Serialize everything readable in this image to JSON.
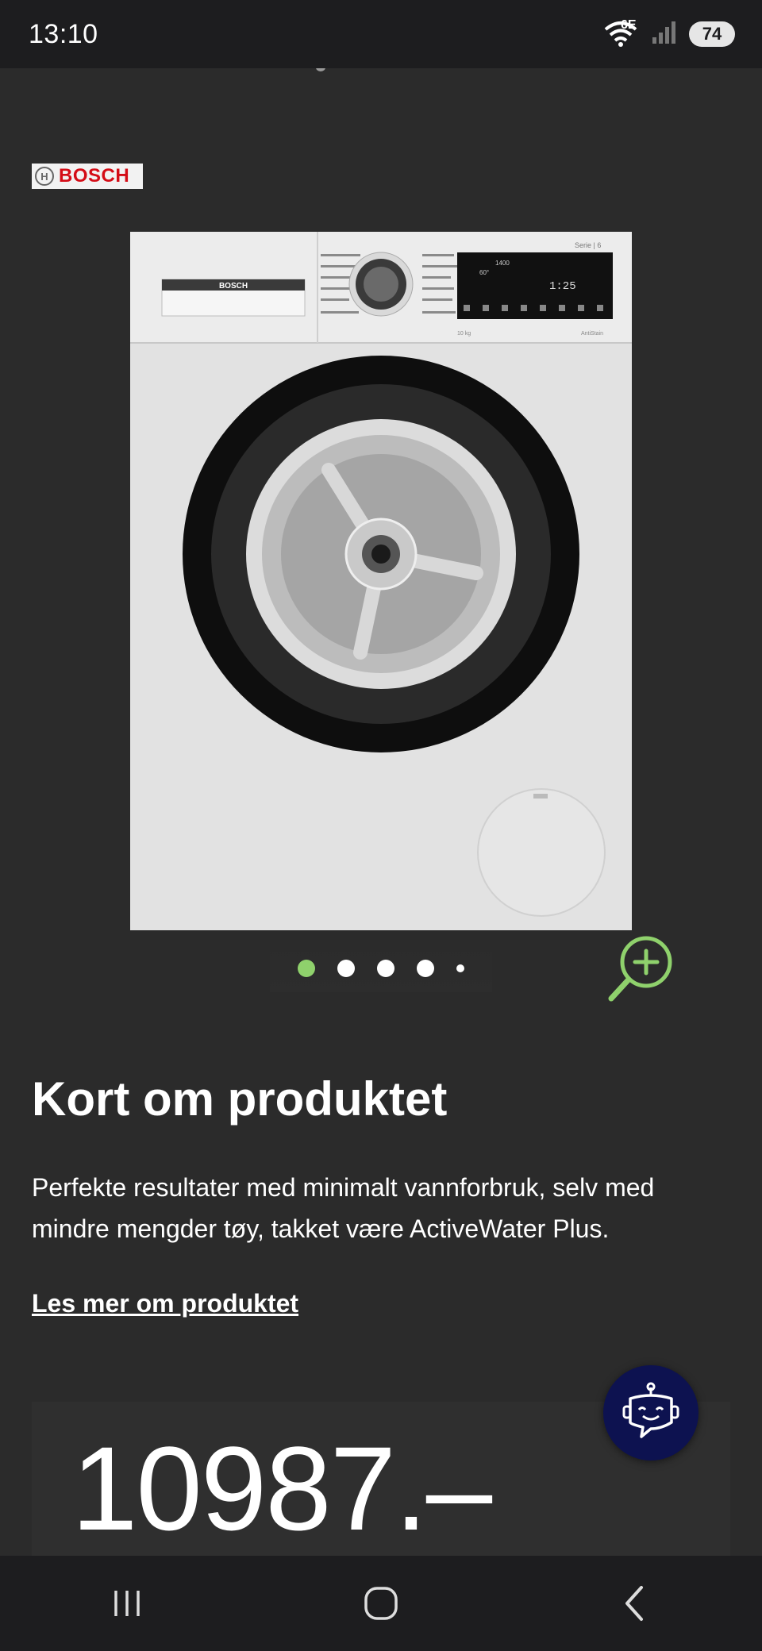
{
  "status_bar": {
    "time": "13:10",
    "network": "6E",
    "battery": "74",
    "icons": [
      "wifi-icon",
      "signal-icon",
      "battery-icon"
    ]
  },
  "brand": {
    "name": "BOSCH"
  },
  "product_image": {
    "panel_brand": "BOSCH",
    "serie_label": "Serie | 6",
    "display_rpm": "1400",
    "display_temp": "60°",
    "display_time": "1:25",
    "capacity": "10 kg",
    "antistain": "AntiStain"
  },
  "carousel": {
    "slides": 5,
    "active_index": 0
  },
  "section": {
    "title": "Kort om produktet",
    "description": "Perfekte resultater med minimalt vannforbruk, selv med mindre mengder tøy, takket være ActiveWater Plus.",
    "read_more": "Les mer om produktet"
  },
  "price": {
    "value": "10987.–"
  },
  "colors": {
    "background": "#2b2b2b",
    "accent_green": "#8fd16c",
    "bot_button": "#0d1250",
    "bosch_red": "#d40c16"
  },
  "nav_bar": {
    "icons": [
      "recent-apps-icon",
      "home-icon",
      "back-icon"
    ]
  }
}
